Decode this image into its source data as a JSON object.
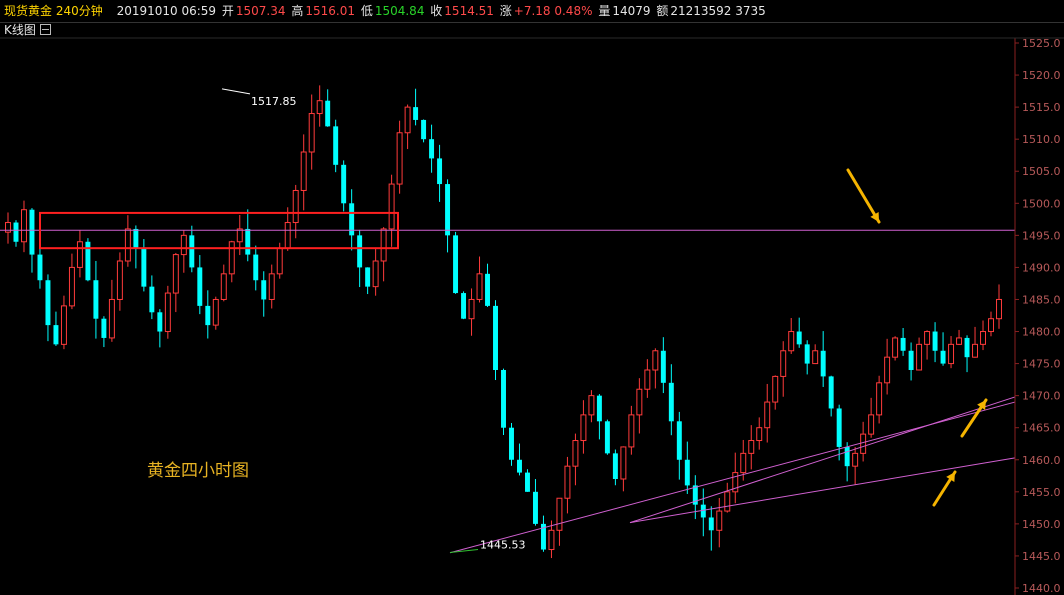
{
  "header": {
    "symbol": "现货黄金 240分钟",
    "date_time": "20191010 06:59",
    "open_label": "开",
    "open_value": "1507.34",
    "high_label": "高",
    "high_value": "1516.01",
    "low_label": "低",
    "low_value": "1504.84",
    "close_label": "收",
    "close_value": "1514.51",
    "change_label": "涨",
    "change_value": "+7.18 0.48%",
    "volume_label": "量",
    "volume_value": "14079",
    "amount_label": "额",
    "amount_value": "21213592 3735"
  },
  "subheader": {
    "title": "K线图"
  },
  "colors": {
    "up": "#ff3b3b",
    "down": "#00ffff",
    "highlight_box": "#ff2020",
    "horizontal_line": "#d060d0",
    "trend_lines": "#d060d0",
    "arrows": "#f5b400",
    "axis": "#8a2020",
    "caption": "#e8b323"
  },
  "chart_data": {
    "type": "candlestick",
    "title": "黄金四小时图",
    "ylim": [
      1440,
      1525
    ],
    "y_ticks": [
      "1525.0",
      "1520.0",
      "1515.0",
      "1510.0",
      "1505.0",
      "1500.0",
      "1495.0",
      "1490.0",
      "1485.0",
      "1480.0",
      "1475.0",
      "1470.0",
      "1465.0",
      "1460.0",
      "1455.0",
      "1450.0",
      "1445.0",
      "1440.0"
    ],
    "annotations": {
      "high": "1517.85",
      "low": "1445.53"
    },
    "horizontal_level": 1495.8,
    "highlight_range": [
      1493.0,
      1498.5
    ],
    "trend_lines": [
      {
        "from": [
          1445.5,
          0.44
        ],
        "to": [
          1469.0,
          1.0
        ]
      },
      {
        "from": [
          1450.2,
          0.59
        ],
        "to": [
          1460.3,
          1.0
        ]
      }
    ],
    "closes": [
      1497,
      1494,
      1499,
      1492,
      1488,
      1481,
      1478,
      1484,
      1490,
      1494,
      1488,
      1482,
      1479,
      1485,
      1491,
      1496,
      1493,
      1487,
      1483,
      1480,
      1486,
      1492,
      1495,
      1490,
      1484,
      1481,
      1485,
      1489,
      1494,
      1496,
      1492,
      1488,
      1485,
      1489,
      1493,
      1497,
      1502,
      1508,
      1514,
      1516,
      1512,
      1506,
      1500,
      1495,
      1490,
      1487,
      1491,
      1496,
      1503,
      1511,
      1515,
      1513,
      1510,
      1507,
      1503,
      1495,
      1486,
      1482,
      1485,
      1489,
      1484,
      1474,
      1465,
      1460,
      1458,
      1455,
      1450,
      1446,
      1449,
      1454,
      1459,
      1463,
      1467,
      1470,
      1466,
      1461,
      1457,
      1462,
      1467,
      1471,
      1474,
      1477,
      1472,
      1466,
      1460,
      1456,
      1453,
      1451,
      1449,
      1452,
      1455,
      1458,
      1461,
      1463,
      1465,
      1469,
      1473,
      1477,
      1480,
      1478,
      1475,
      1477,
      1473,
      1468,
      1462,
      1459,
      1461,
      1464,
      1467,
      1472,
      1476,
      1479,
      1477,
      1474,
      1478,
      1480,
      1477,
      1475,
      1478,
      1479,
      1476,
      1478,
      1480,
      1482,
      1485
    ],
    "values_note_hidden": ""
  }
}
